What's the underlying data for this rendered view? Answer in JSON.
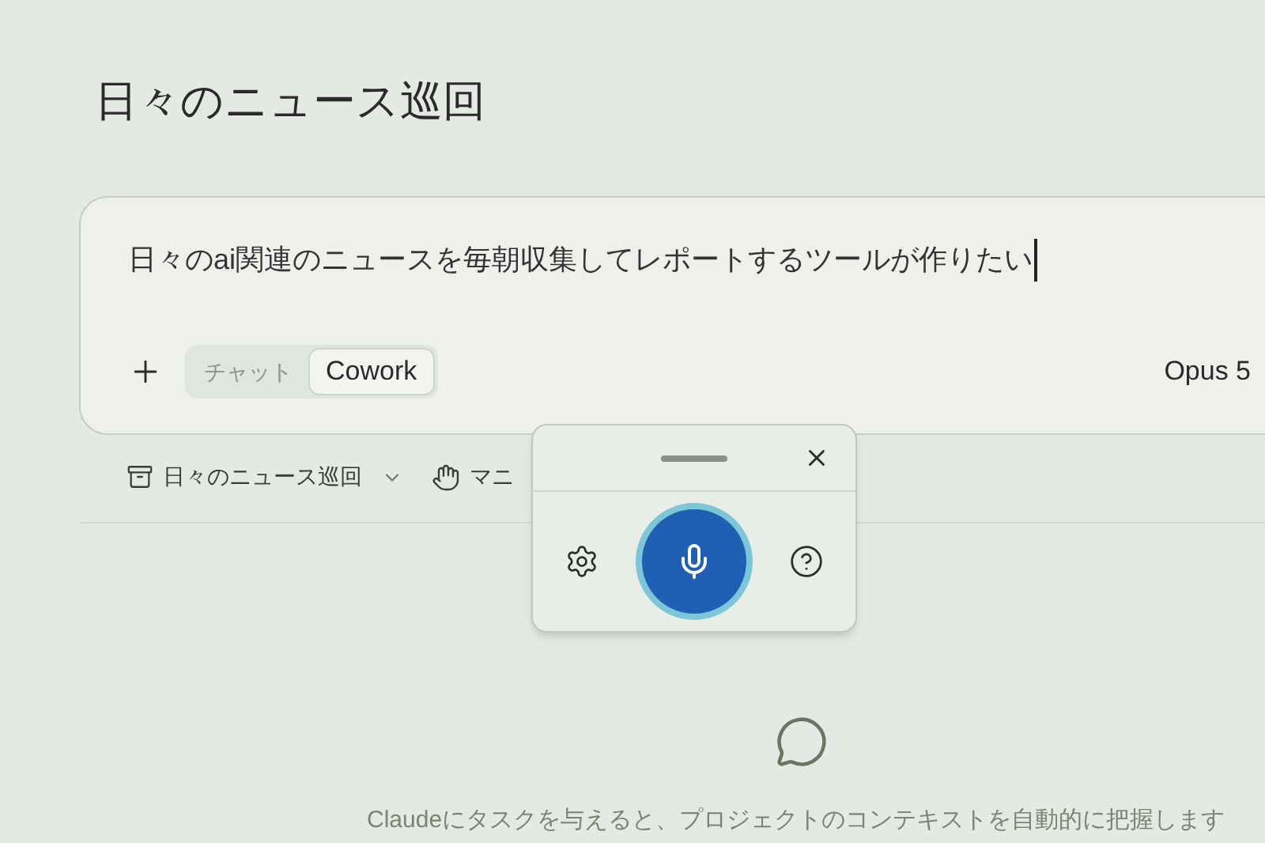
{
  "page_title": "日々のニュース巡回",
  "composer": {
    "value": "日々のai関連のニュースを毎朝収集してレポートするツールが作りたい",
    "modes": [
      {
        "label": "チャット",
        "selected": false
      },
      {
        "label": "Cowork",
        "selected": true
      }
    ],
    "model": "Opus 5"
  },
  "project_bar": {
    "project": "日々のニュース巡回",
    "item_2": "マニ"
  },
  "voice_popup": {
    "listening": true
  },
  "empty_state": {
    "text": "Claudeにタスクを与えると、プロジェクトのコンテキストを自動的に把握します"
  }
}
